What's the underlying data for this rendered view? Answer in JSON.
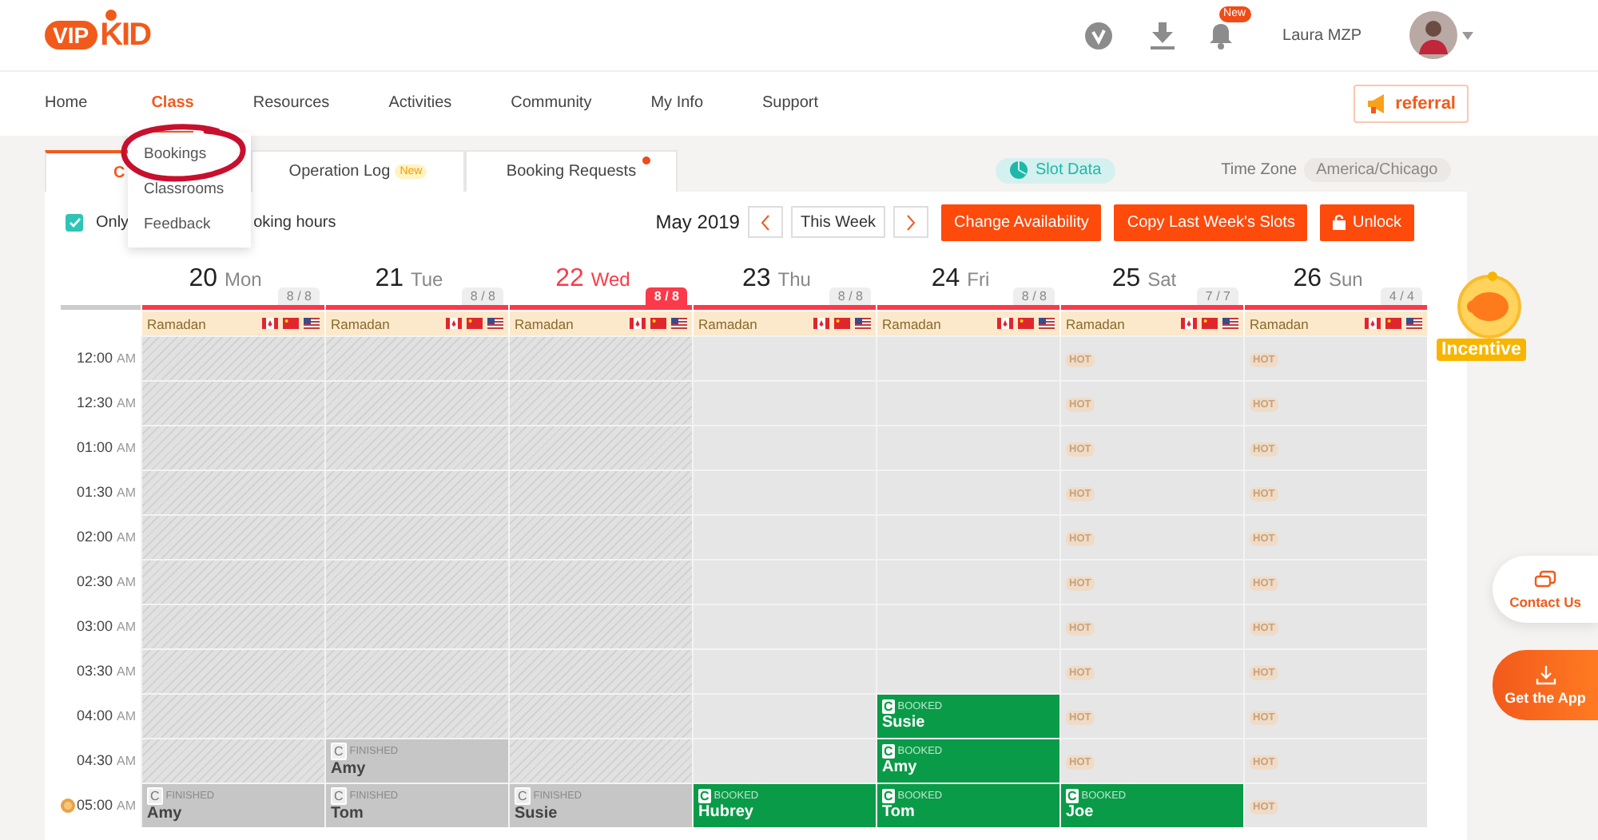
{
  "header": {
    "logo": {
      "badge": "VIP",
      "text": "KID"
    },
    "notification_badge": "New",
    "user_name": "Laura MZP"
  },
  "nav": {
    "items": [
      {
        "label": "Home",
        "selected": false
      },
      {
        "label": "Class",
        "selected": true
      },
      {
        "label": "Resources",
        "selected": false
      },
      {
        "label": "Activities",
        "selected": false
      },
      {
        "label": "Community",
        "selected": false
      },
      {
        "label": "My Info",
        "selected": false
      },
      {
        "label": "Support",
        "selected": false
      }
    ],
    "referral": "referral",
    "dropdown": [
      {
        "label": "Bookings",
        "circled": true
      },
      {
        "label": "Classrooms",
        "circled": false
      },
      {
        "label": "Feedback",
        "circled": false
      }
    ]
  },
  "tabs": [
    {
      "label": "C",
      "selected": true
    },
    {
      "label": "Operation Log",
      "badge": "New",
      "dot": false,
      "selected": false
    },
    {
      "label": "Booking Requests",
      "dot": true,
      "selected": false
    }
  ],
  "slot_data": "Slot Data",
  "time_zone": {
    "label": "Time Zone",
    "value": "America/Chicago"
  },
  "filter": {
    "checked": true,
    "label_parts": [
      "Only",
      "oking hours"
    ]
  },
  "week": {
    "month": "May 2019",
    "current": "This Week"
  },
  "actions": [
    {
      "label": "Change Availability",
      "kind": "primary"
    },
    {
      "label": "Copy Last Week's Slots",
      "kind": "primary"
    },
    {
      "label": "Unlock",
      "kind": "lock"
    }
  ],
  "calendar": {
    "days": [
      {
        "date": "20",
        "weekday": "Mon",
        "count": "8 / 8",
        "today": false,
        "holiday": "Ramadan"
      },
      {
        "date": "21",
        "weekday": "Tue",
        "count": "8 / 8",
        "today": false,
        "holiday": "Ramadan"
      },
      {
        "date": "22",
        "weekday": "Wed",
        "count": "8 / 8",
        "today": true,
        "holiday": "Ramadan"
      },
      {
        "date": "23",
        "weekday": "Thu",
        "count": "8 / 8",
        "today": false,
        "holiday": "Ramadan"
      },
      {
        "date": "24",
        "weekday": "Fri",
        "count": "8 / 8",
        "today": false,
        "holiday": "Ramadan"
      },
      {
        "date": "25",
        "weekday": "Sat",
        "count": "7 / 7",
        "today": false,
        "holiday": "Ramadan"
      },
      {
        "date": "26",
        "weekday": "Sun",
        "count": "4 / 4",
        "today": false,
        "holiday": "Ramadan"
      }
    ],
    "rows": [
      {
        "time": "12:00",
        "period": "AM",
        "coin": false,
        "cells": [
          {
            "kind": "blocked"
          },
          {
            "kind": "blocked"
          },
          {
            "kind": "blocked"
          },
          {
            "kind": "empty"
          },
          {
            "kind": "empty"
          },
          {
            "kind": "hot",
            "label": "HOT"
          },
          {
            "kind": "hot",
            "label": "HOT"
          }
        ]
      },
      {
        "time": "12:30",
        "period": "AM",
        "coin": false,
        "cells": [
          {
            "kind": "blocked"
          },
          {
            "kind": "blocked"
          },
          {
            "kind": "blocked"
          },
          {
            "kind": "empty"
          },
          {
            "kind": "empty"
          },
          {
            "kind": "hot",
            "label": "HOT"
          },
          {
            "kind": "hot",
            "label": "HOT"
          }
        ]
      },
      {
        "time": "01:00",
        "period": "AM",
        "coin": false,
        "cells": [
          {
            "kind": "blocked"
          },
          {
            "kind": "blocked"
          },
          {
            "kind": "blocked"
          },
          {
            "kind": "empty"
          },
          {
            "kind": "empty"
          },
          {
            "kind": "hot",
            "label": "HOT"
          },
          {
            "kind": "hot",
            "label": "HOT"
          }
        ]
      },
      {
        "time": "01:30",
        "period": "AM",
        "coin": false,
        "cells": [
          {
            "kind": "blocked"
          },
          {
            "kind": "blocked"
          },
          {
            "kind": "blocked"
          },
          {
            "kind": "empty"
          },
          {
            "kind": "empty"
          },
          {
            "kind": "hot",
            "label": "HOT"
          },
          {
            "kind": "hot",
            "label": "HOT"
          }
        ]
      },
      {
        "time": "02:00",
        "period": "AM",
        "coin": false,
        "cells": [
          {
            "kind": "blocked"
          },
          {
            "kind": "blocked"
          },
          {
            "kind": "blocked"
          },
          {
            "kind": "empty"
          },
          {
            "kind": "empty"
          },
          {
            "kind": "hot",
            "label": "HOT"
          },
          {
            "kind": "hot",
            "label": "HOT"
          }
        ]
      },
      {
        "time": "02:30",
        "period": "AM",
        "coin": false,
        "cells": [
          {
            "kind": "blocked"
          },
          {
            "kind": "blocked"
          },
          {
            "kind": "blocked"
          },
          {
            "kind": "empty"
          },
          {
            "kind": "empty"
          },
          {
            "kind": "hot",
            "label": "HOT"
          },
          {
            "kind": "hot",
            "label": "HOT"
          }
        ]
      },
      {
        "time": "03:00",
        "period": "AM",
        "coin": false,
        "cells": [
          {
            "kind": "blocked"
          },
          {
            "kind": "blocked"
          },
          {
            "kind": "blocked"
          },
          {
            "kind": "empty"
          },
          {
            "kind": "empty"
          },
          {
            "kind": "hot",
            "label": "HOT"
          },
          {
            "kind": "hot",
            "label": "HOT"
          }
        ]
      },
      {
        "time": "03:30",
        "period": "AM",
        "coin": false,
        "cells": [
          {
            "kind": "blocked"
          },
          {
            "kind": "blocked"
          },
          {
            "kind": "blocked"
          },
          {
            "kind": "empty"
          },
          {
            "kind": "empty"
          },
          {
            "kind": "hot",
            "label": "HOT"
          },
          {
            "kind": "hot",
            "label": "HOT"
          }
        ]
      },
      {
        "time": "04:00",
        "period": "AM",
        "coin": false,
        "cells": [
          {
            "kind": "blocked"
          },
          {
            "kind": "blocked"
          },
          {
            "kind": "blocked"
          },
          {
            "kind": "empty"
          },
          {
            "kind": "booked",
            "course": "C",
            "status": "BOOKED",
            "student": "Susie"
          },
          {
            "kind": "hot",
            "label": "HOT"
          },
          {
            "kind": "hot",
            "label": "HOT"
          }
        ]
      },
      {
        "time": "04:30",
        "period": "AM",
        "coin": false,
        "cells": [
          {
            "kind": "blocked"
          },
          {
            "kind": "finished",
            "course": "C",
            "status": "FINISHED",
            "student": "Amy"
          },
          {
            "kind": "blocked"
          },
          {
            "kind": "empty"
          },
          {
            "kind": "booked",
            "course": "C",
            "status": "BOOKED",
            "student": "Amy"
          },
          {
            "kind": "hot",
            "label": "HOT"
          },
          {
            "kind": "hot",
            "label": "HOT"
          }
        ]
      },
      {
        "time": "05:00",
        "period": "AM",
        "coin": true,
        "cells": [
          {
            "kind": "finished",
            "course": "C",
            "status": "FINISHED",
            "student": "Amy"
          },
          {
            "kind": "finished",
            "course": "C",
            "status": "FINISHED",
            "student": "Tom"
          },
          {
            "kind": "finished",
            "course": "C",
            "status": "FINISHED",
            "student": "Susie"
          },
          {
            "kind": "booked",
            "course": "C",
            "status": "BOOKED",
            "student": "Hubrey"
          },
          {
            "kind": "booked",
            "course": "C",
            "status": "BOOKED",
            "student": "Tom"
          },
          {
            "kind": "booked",
            "course": "C",
            "status": "BOOKED",
            "student": "Joe"
          },
          {
            "kind": "hot",
            "label": "HOT"
          }
        ]
      }
    ]
  },
  "floating": {
    "incentive": "Incentive",
    "contact": "Contact Us",
    "app": "Get the App"
  }
}
